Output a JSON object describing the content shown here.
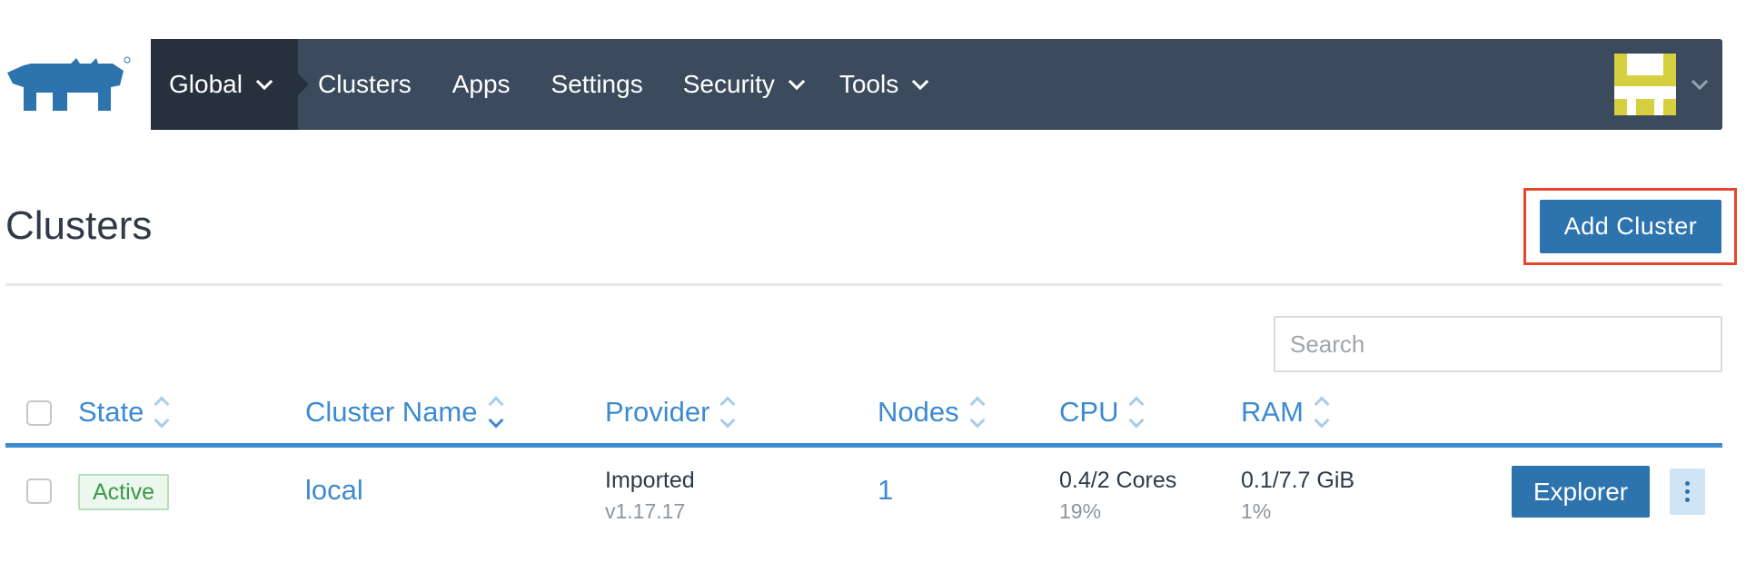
{
  "nav": {
    "global_label": "Global",
    "items": [
      "Clusters",
      "Apps",
      "Settings",
      "Security",
      "Tools"
    ]
  },
  "brand": {
    "logo_icon": "rancher-cow-logo-icon",
    "color": "#2d73ad"
  },
  "page": {
    "title": "Clusters",
    "add_button_label": "Add Cluster",
    "highlight_color": "#e8452f"
  },
  "search": {
    "placeholder": "Search",
    "value": ""
  },
  "table": {
    "columns": [
      "State",
      "Cluster Name",
      "Provider",
      "Nodes",
      "CPU",
      "RAM"
    ],
    "rows": [
      {
        "state": "Active",
        "name": "local",
        "provider": "Imported",
        "provider_version": "v1.17.17",
        "nodes": "1",
        "cpu": "0.4/2 Cores",
        "cpu_pct": "19%",
        "ram": "0.1/7.7 GiB",
        "ram_pct": "1%",
        "action_label": "Explorer"
      }
    ]
  },
  "colors": {
    "nav_bg": "#3b4a5d",
    "nav_active_bg": "#27313e",
    "link": "#3d8ad1",
    "button": "#2d73ad",
    "active_badge": "#3c9a48"
  }
}
